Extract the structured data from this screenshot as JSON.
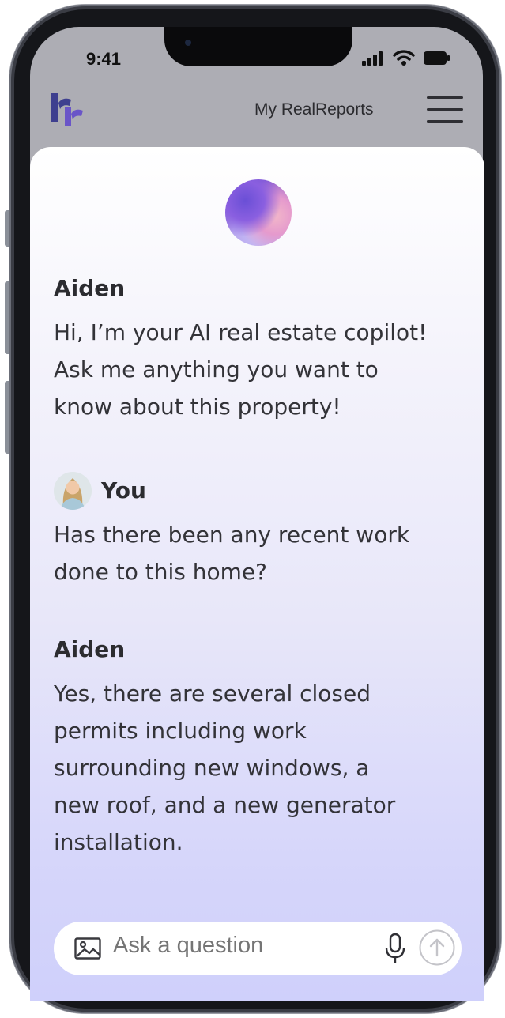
{
  "status_bar": {
    "time": "9:41"
  },
  "header": {
    "logo_icon": "realreports-logo",
    "title": "My RealReports",
    "menu_icon": "hamburger-menu-icon"
  },
  "chat": {
    "assistant_orb_icon": "ai-orb-icon",
    "messages": [
      {
        "speaker": "Aiden",
        "lines": [
          "Hi, I’m your AI real estate copilot!",
          "Ask me anything you want to",
          "know about this property!"
        ]
      },
      {
        "speaker": "You",
        "lines": [
          "Has there been any recent work",
          "done to this home?"
        ]
      },
      {
        "speaker": "Aiden",
        "lines": [
          "Yes, there are several closed",
          "permits including work",
          "surrounding new windows, a",
          "new roof, and a new generator",
          "installation."
        ]
      }
    ]
  },
  "input": {
    "placeholder": "Ask a question",
    "image_icon": "image-icon",
    "mic_icon": "microphone-icon",
    "send_icon": "send-arrow-icon"
  },
  "colors": {
    "brand": "#4a3aa8",
    "text": "#333338",
    "card_gradient_end": "#cfd0fb"
  }
}
